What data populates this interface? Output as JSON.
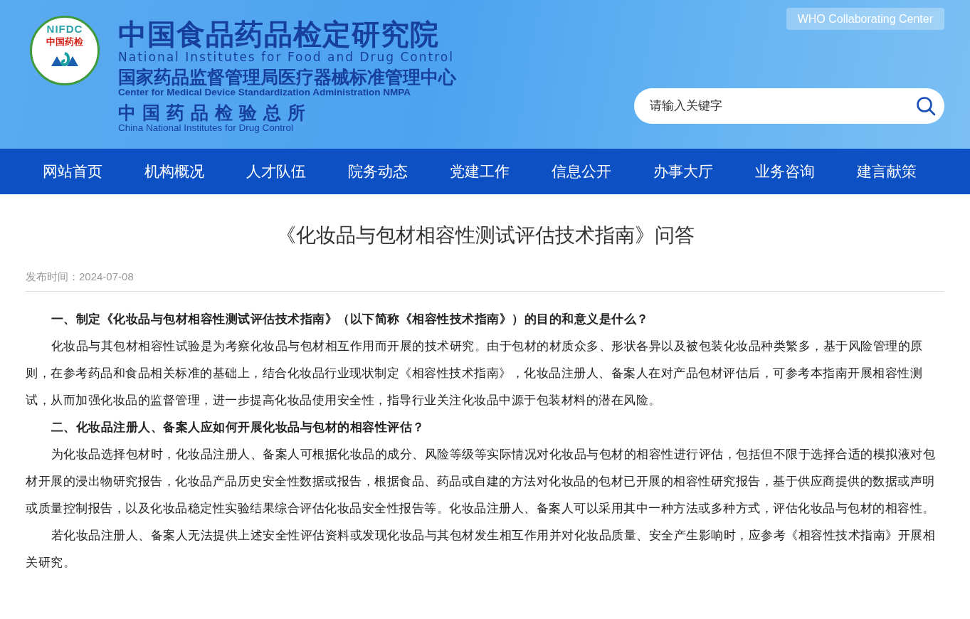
{
  "header": {
    "logo": {
      "acronym": "NIFDC",
      "badge": "中国药检"
    },
    "names": [
      {
        "cn": "中国食品药品检定研究院",
        "en": "National Institutes for Food and Drug Control",
        "kind": "main"
      },
      {
        "cn": "国家药品监督管理局医疗器械标准管理中心",
        "en": "Center for Medical Device Standardization Administration NMPA",
        "kind": "sub"
      },
      {
        "cn": "中国药品检验总所",
        "en": "China National Institutes for Drug Control",
        "kind": "spaced"
      }
    ],
    "who_badge": "WHO Collaborating Center",
    "search": {
      "placeholder": "请输入关键字"
    }
  },
  "nav": {
    "items": [
      {
        "label": "网站首页"
      },
      {
        "label": "机构概况"
      },
      {
        "label": "人才队伍"
      },
      {
        "label": "院务动态"
      },
      {
        "label": "党建工作"
      },
      {
        "label": "信息公开"
      },
      {
        "label": "办事大厅"
      },
      {
        "label": "业务咨询"
      },
      {
        "label": "建言献策"
      }
    ]
  },
  "article": {
    "title": "《化妆品与包材相容性测试评估技术指南》问答",
    "date": "发布时间：2024-07-08",
    "paragraphs": [
      {
        "kind": "heading",
        "text": "一、制定《化妆品与包材相容性测试评估技术指南》（以下简称《相容性技术指南》）的目的和意义是什么？"
      },
      {
        "kind": "body",
        "text": "化妆品与其包材相容性试验是为考察化妆品与包材相互作用而开展的技术研究。由于包材的材质众多、形状各异以及被包装化妆品种类繁多，基于风险管理的原则，在参考药品和食品相关标准的基础上，结合化妆品行业现状制定《相容性技术指南》，化妆品注册人、备案人在对产品包材评估后，可参考本指南开展相容性测试，从而加强化妆品的监督管理，进一步提高化妆品使用安全性，指导行业关注化妆品中源于包装材料的潜在风险。"
      },
      {
        "kind": "heading",
        "text": "二、化妆品注册人、备案人应如何开展化妆品与包材的相容性评估？"
      },
      {
        "kind": "body",
        "text": "为化妆品选择包材时，化妆品注册人、备案人可根据化妆品的成分、风险等级等实际情况对化妆品与包材的相容性进行评估，包括但不限于选择合适的模拟液对包材开展的浸出物研究报告，化妆品产品历史安全性数据或报告，根据食品、药品或自建的方法对化妆品的包材已开展的相容性研究报告，基于供应商提供的数据或声明或质量控制报告，以及化妆品稳定性实验结果综合评估化妆品安全性报告等。化妆品注册人、备案人可以采用其中一种方法或多种方式，评估化妆品与包材的相容性。"
      },
      {
        "kind": "body",
        "text": "若化妆品注册人、备案人无法提供上述安全性评估资料或发现化妆品与其包材发生相互作用并对化妆品质量、安全产生影响时，应参考《相容性技术指南》开展相关研究。"
      }
    ]
  }
}
